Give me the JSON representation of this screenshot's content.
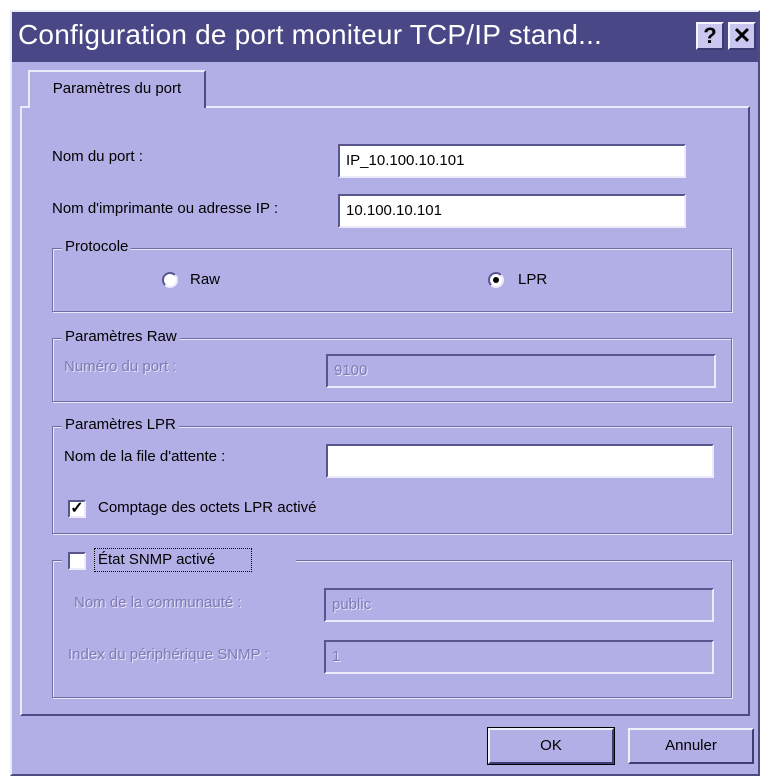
{
  "window": {
    "title": "Configuration de port moniteur TCP/IP stand...",
    "help_glyph": "?",
    "close_glyph": "✕"
  },
  "tabs": [
    {
      "label": "Paramètres du port"
    }
  ],
  "port": {
    "name_label": "Nom du port :",
    "name_value": "IP_10.100.10.101",
    "address_label": "Nom d'imprimante ou adresse IP :",
    "address_value": "10.100.10.101"
  },
  "protocol": {
    "title": "Protocole",
    "raw_label": "Raw",
    "lpr_label": "LPR",
    "selected": "LPR"
  },
  "raw_settings": {
    "title": "Paramètres Raw",
    "port_number_label": "Numéro du port :",
    "port_number_value": "9100"
  },
  "lpr_settings": {
    "title": "Paramètres LPR",
    "queue_label": "Nom de la file d'attente :",
    "queue_value": "",
    "byte_count_label": "Comptage des octets LPR activé",
    "byte_count_checked": true
  },
  "snmp": {
    "status_label": "État SNMP activé",
    "status_checked": false,
    "community_label": "Nom de la communauté :",
    "community_value": "public",
    "device_index_label": "Index du périphérique SNMP :",
    "device_index_value": "1"
  },
  "buttons": {
    "ok": "OK",
    "cancel": "Annuler"
  }
}
